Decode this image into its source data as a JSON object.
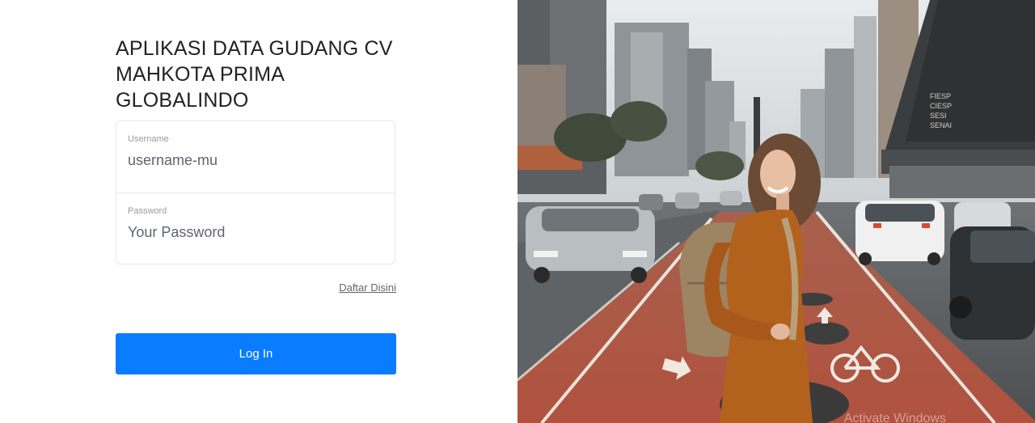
{
  "app": {
    "title": "APLIKASI DATA GUDANG CV MAHKOTA PRIMA GLOBALINDO"
  },
  "form": {
    "username": {
      "label": "Username",
      "placeholder": "username-mu"
    },
    "password": {
      "label": "Password",
      "placeholder": "Your Password"
    },
    "register_link": "Daftar Disini",
    "login_button": "Log In"
  },
  "hero_image": {
    "description_icon": "city-street-photo",
    "sign_text": "FIESP CIESP SESI SENAI",
    "watermark": "Activate Windows"
  },
  "colors": {
    "accent": "#0a7cff",
    "bike_lane": "#b0523f"
  }
}
